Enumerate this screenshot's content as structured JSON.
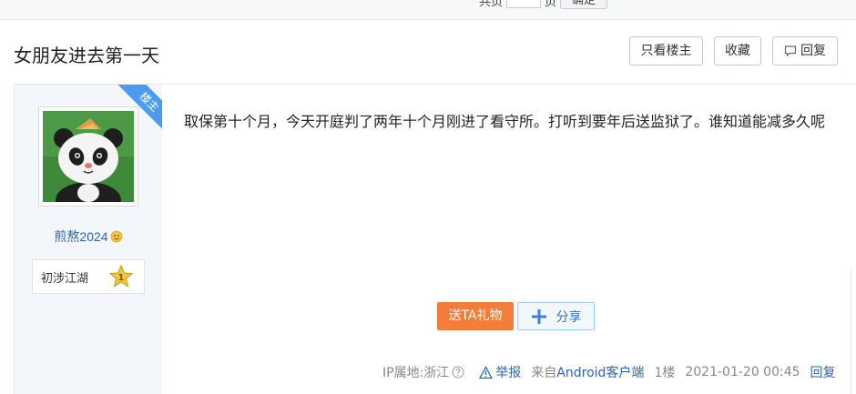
{
  "pager": {
    "prefix": "共页",
    "suffix": "页",
    "go_label": "确定"
  },
  "thread": {
    "title": "女朋友进去第一天",
    "buttons": {
      "only_author": "只看楼主",
      "favorite": "收藏",
      "reply": "回复"
    }
  },
  "post": {
    "corner_badge": "楼主",
    "author": {
      "name": "煎熬2024",
      "level_name": "初涉江湖",
      "level_number": "1"
    },
    "content": "取保第十个月，今天开庭判了两年十个月刚进了看守所。打听到要年后送监狱了。谁知道能减多久呢",
    "actions": {
      "gift": "送TA礼物",
      "share": "分享"
    },
    "footer": {
      "ip_location": "IP属地:浙江",
      "report": "举报",
      "from_prefix": "来自",
      "client": "Android客户端",
      "floor": "1楼",
      "date": "2021-01-20 00:45",
      "reply": "回复"
    }
  },
  "colors": {
    "link": "#2d64b3",
    "gift": "#f47d3a",
    "badge": "#4c9bf2"
  },
  "icons": [
    "reply-icon",
    "emoji-icon",
    "star-level-icon",
    "plus-icon",
    "help-icon",
    "warning-icon"
  ]
}
